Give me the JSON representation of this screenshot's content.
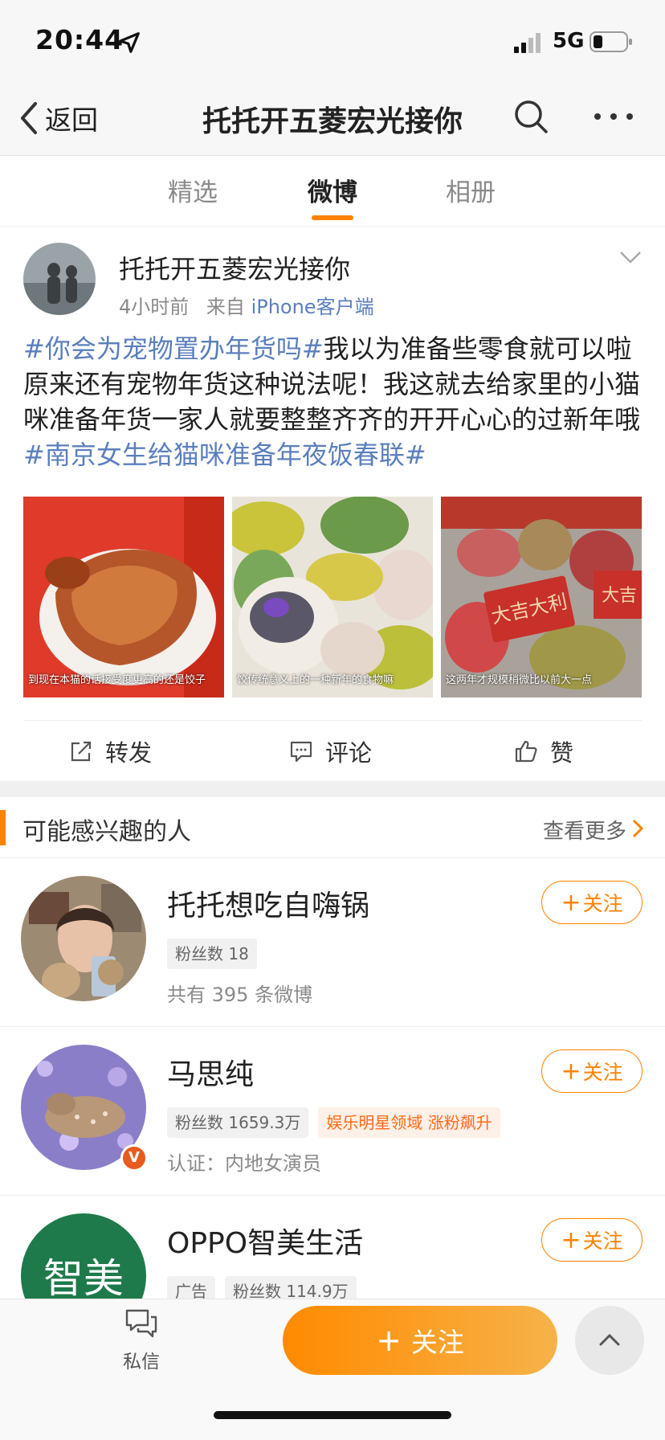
{
  "status_bar": {
    "time": "20:44",
    "network": "5G"
  },
  "nav": {
    "back_label": "返回",
    "title": "托托开五菱宏光接你"
  },
  "tabs": [
    {
      "label": "精选"
    },
    {
      "label": "微博"
    },
    {
      "label": "相册"
    }
  ],
  "post": {
    "author": "托托开五菱宏光接你",
    "time": "4小时前",
    "source_prefix": "来自",
    "source": "iPhone客户端",
    "topic1": "#你会为宠物置办年货吗#",
    "body": "我以为准备些零食就可以啦原来还有宠物年货这种说法呢！我这就去给家里的小猫咪准备年货一家人就要整整齐齐的开开心心的过新年哦",
    "topic2": "#南京女生给猫咪准备年夜饭春联#",
    "image_captions": [
      "到现在本猫的话接受度更高的还是饺子",
      "饺传统意义上的一种新年的食物嘛",
      "这两年才规模稍微比以前大一点"
    ],
    "image_text": {
      "image3_label": "大吉大利",
      "image3_label2": "大吉"
    },
    "actions": {
      "repost": "转发",
      "comment": "评论",
      "like": "赞"
    }
  },
  "recommend": {
    "title": "可能感兴趣的人",
    "more": "查看更多",
    "users": [
      {
        "name": "托托想吃自嗨锅",
        "tags": [
          "粉丝数 18"
        ],
        "desc": "共有 395 条微博",
        "follow": "关注"
      },
      {
        "name": "马思纯",
        "tags": [
          "粉丝数 1659.3万"
        ],
        "hot_tag": "娱乐明星领域 涨粉飙升",
        "desc": "认证：内地女演员",
        "follow": "关注",
        "badge": "V"
      },
      {
        "name": "OPPO智美生活",
        "tags": [
          "广告",
          "粉丝数 114.9万"
        ],
        "avatar_text": "智美",
        "follow": "关注"
      }
    ]
  },
  "bottom": {
    "message_label": "私信",
    "follow_label": "关注"
  },
  "colors": {
    "accent": "#ff8200",
    "link": "#5b7fbd"
  }
}
